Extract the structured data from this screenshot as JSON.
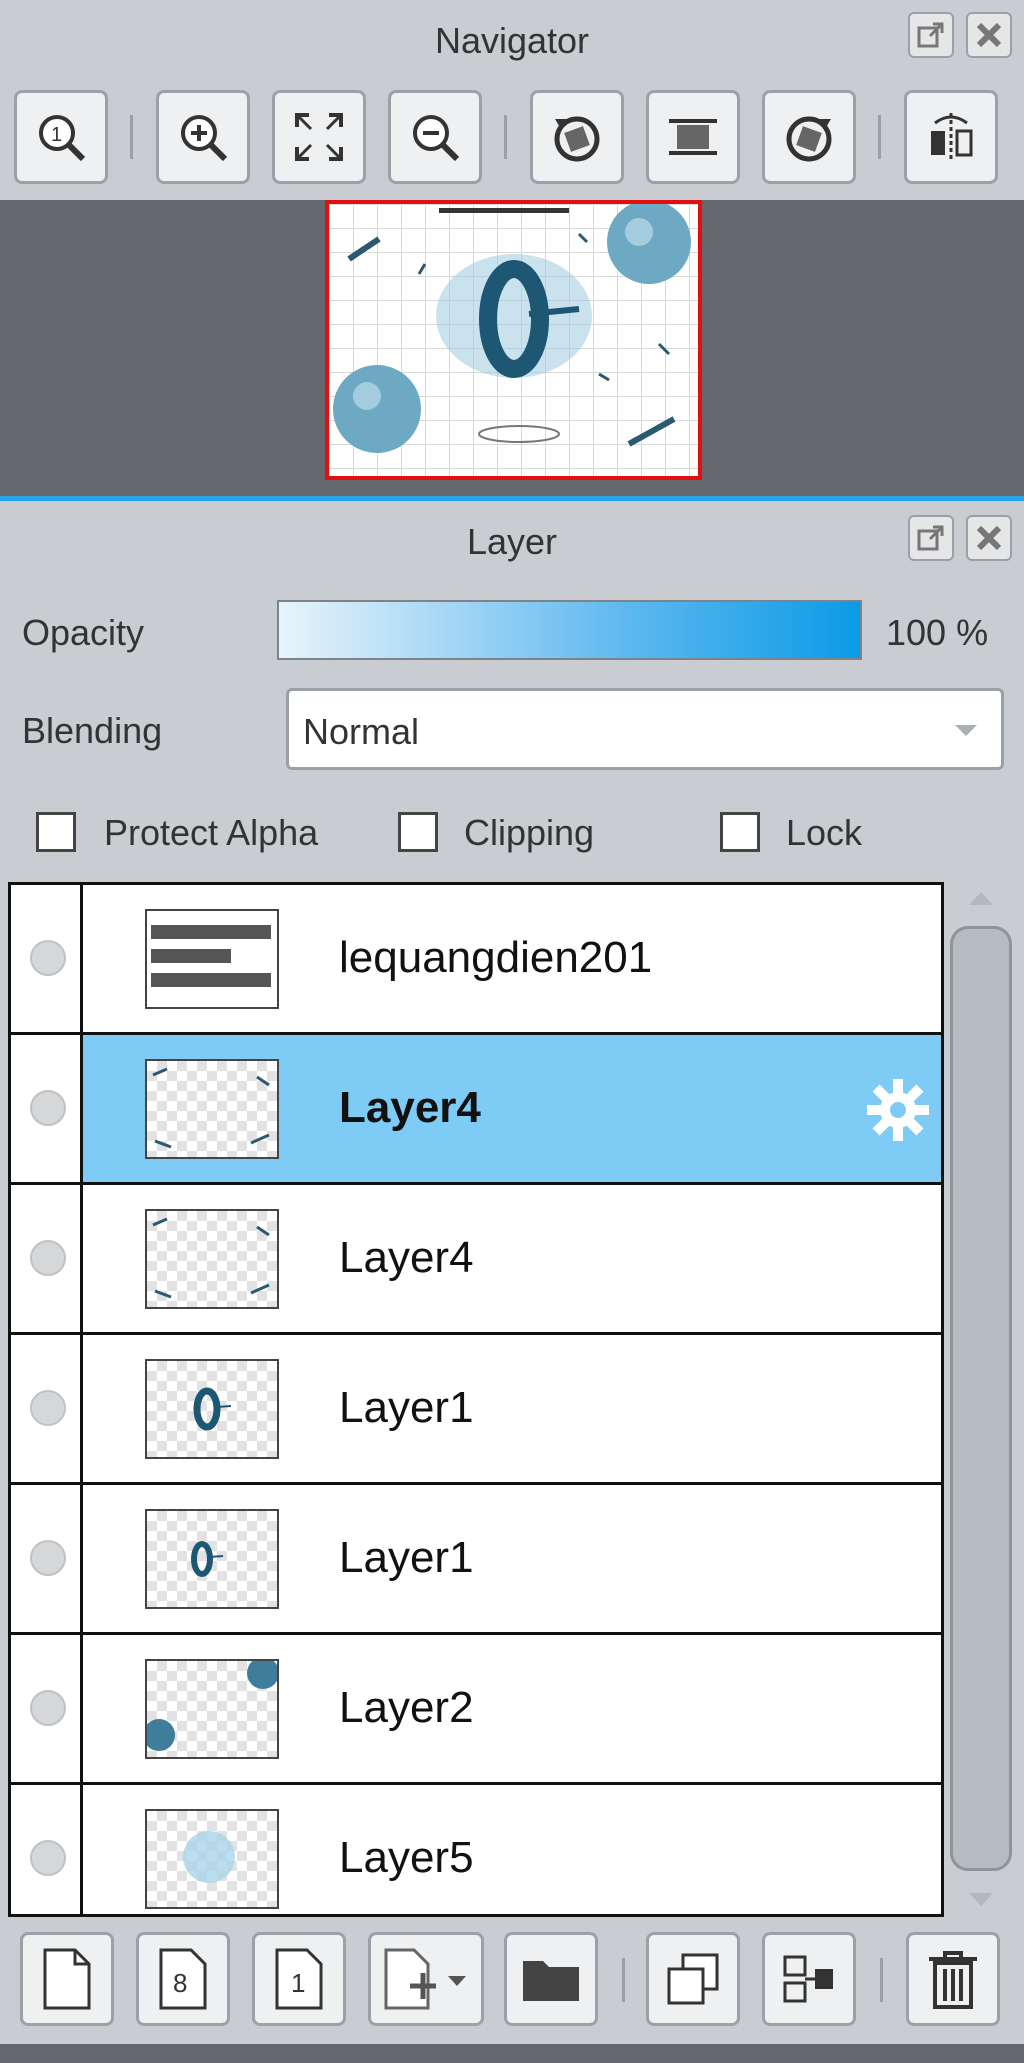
{
  "navigator": {
    "title": "Navigator",
    "toolbar_icons": [
      "zoom-actual-icon",
      "zoom-in-icon",
      "fit-screen-icon",
      "zoom-out-icon",
      "rotate-left-icon",
      "reset-view-icon",
      "rotate-right-icon",
      "flip-horizontal-icon"
    ],
    "frame_color": "#e01010"
  },
  "layer_panel": {
    "title": "Layer",
    "opacity_label": "Opacity",
    "opacity_value": "100 %",
    "opacity": 1.0,
    "blending_label": "Blending",
    "blending_value": "Normal",
    "protect_alpha_label": "Protect Alpha",
    "clipping_label": "Clipping",
    "lock_label": "Lock"
  },
  "layers": [
    {
      "name": "lequangdien201",
      "selected": false
    },
    {
      "name": "Layer4",
      "selected": true
    },
    {
      "name": "Layer4",
      "selected": false
    },
    {
      "name": "Layer1",
      "selected": false
    },
    {
      "name": "Layer1",
      "selected": false
    },
    {
      "name": "Layer2",
      "selected": false
    },
    {
      "name": "Layer5",
      "selected": false
    }
  ],
  "bottom_toolbar_icons": [
    "new-layer-icon",
    "new-8bit-layer-icon",
    "new-1bit-layer-icon",
    "add-layer-menu-icon",
    "new-folder-icon",
    "duplicate-layer-icon",
    "merge-down-icon",
    "delete-layer-icon"
  ],
  "colors": {
    "selection": "#7ecbf5",
    "accent": "#29a3e8"
  }
}
